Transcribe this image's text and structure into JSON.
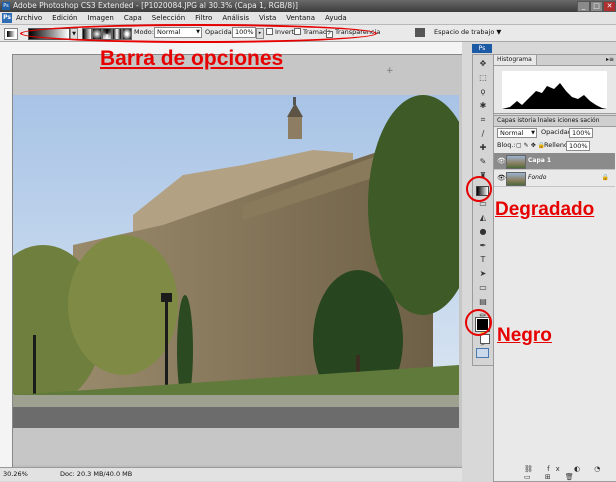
{
  "window": {
    "title": "Adobe Photoshop CS3 Extended - [P1020084.JPG al 30.3% (Capa 1, RGB/8)]",
    "buttons": [
      "_",
      "□",
      "✕"
    ]
  },
  "menu": {
    "app_icon": "Ps",
    "items": [
      "Archivo",
      "Edición",
      "Imagen",
      "Capa",
      "Selección",
      "Filtro",
      "Análisis",
      "Vista",
      "Ventana",
      "Ayuda"
    ]
  },
  "options": {
    "mode_label": "Modo:",
    "mode_value": "Normal",
    "opacity_label": "Opacidad:",
    "opacity_value": "100%",
    "invert_label": "Invertir",
    "dither_label": "Tramado",
    "transparency_label": "Transparencia",
    "workspace_label": "Espacio de trabajo"
  },
  "annotations": {
    "options_bar": "Barra de opciones",
    "gradient": "Degradado",
    "black": "Negro",
    "color": "#e60000"
  },
  "status": {
    "zoom": "30.26%",
    "doc": "Doc: 20.3 MB/40.0 MB"
  },
  "panels": {
    "histogram_tab": "Histograma",
    "layers_tabs": "Capas  istoria  lnales  iciones  sación",
    "blend_mode": "Normal",
    "opacity_label": "Opacidad:",
    "opacity_value": "100%",
    "lock_label": "Bloq.:",
    "fill_label": "Relleno:",
    "fill_value": "100%",
    "layers": [
      {
        "name": "Capa 1",
        "selected": true
      },
      {
        "name": "Fondo",
        "selected": false
      }
    ]
  },
  "colors": {
    "accent": "#e60000",
    "layer_selected": "#8b8b8b",
    "foreground": "#000000",
    "background": "#ffffff"
  }
}
